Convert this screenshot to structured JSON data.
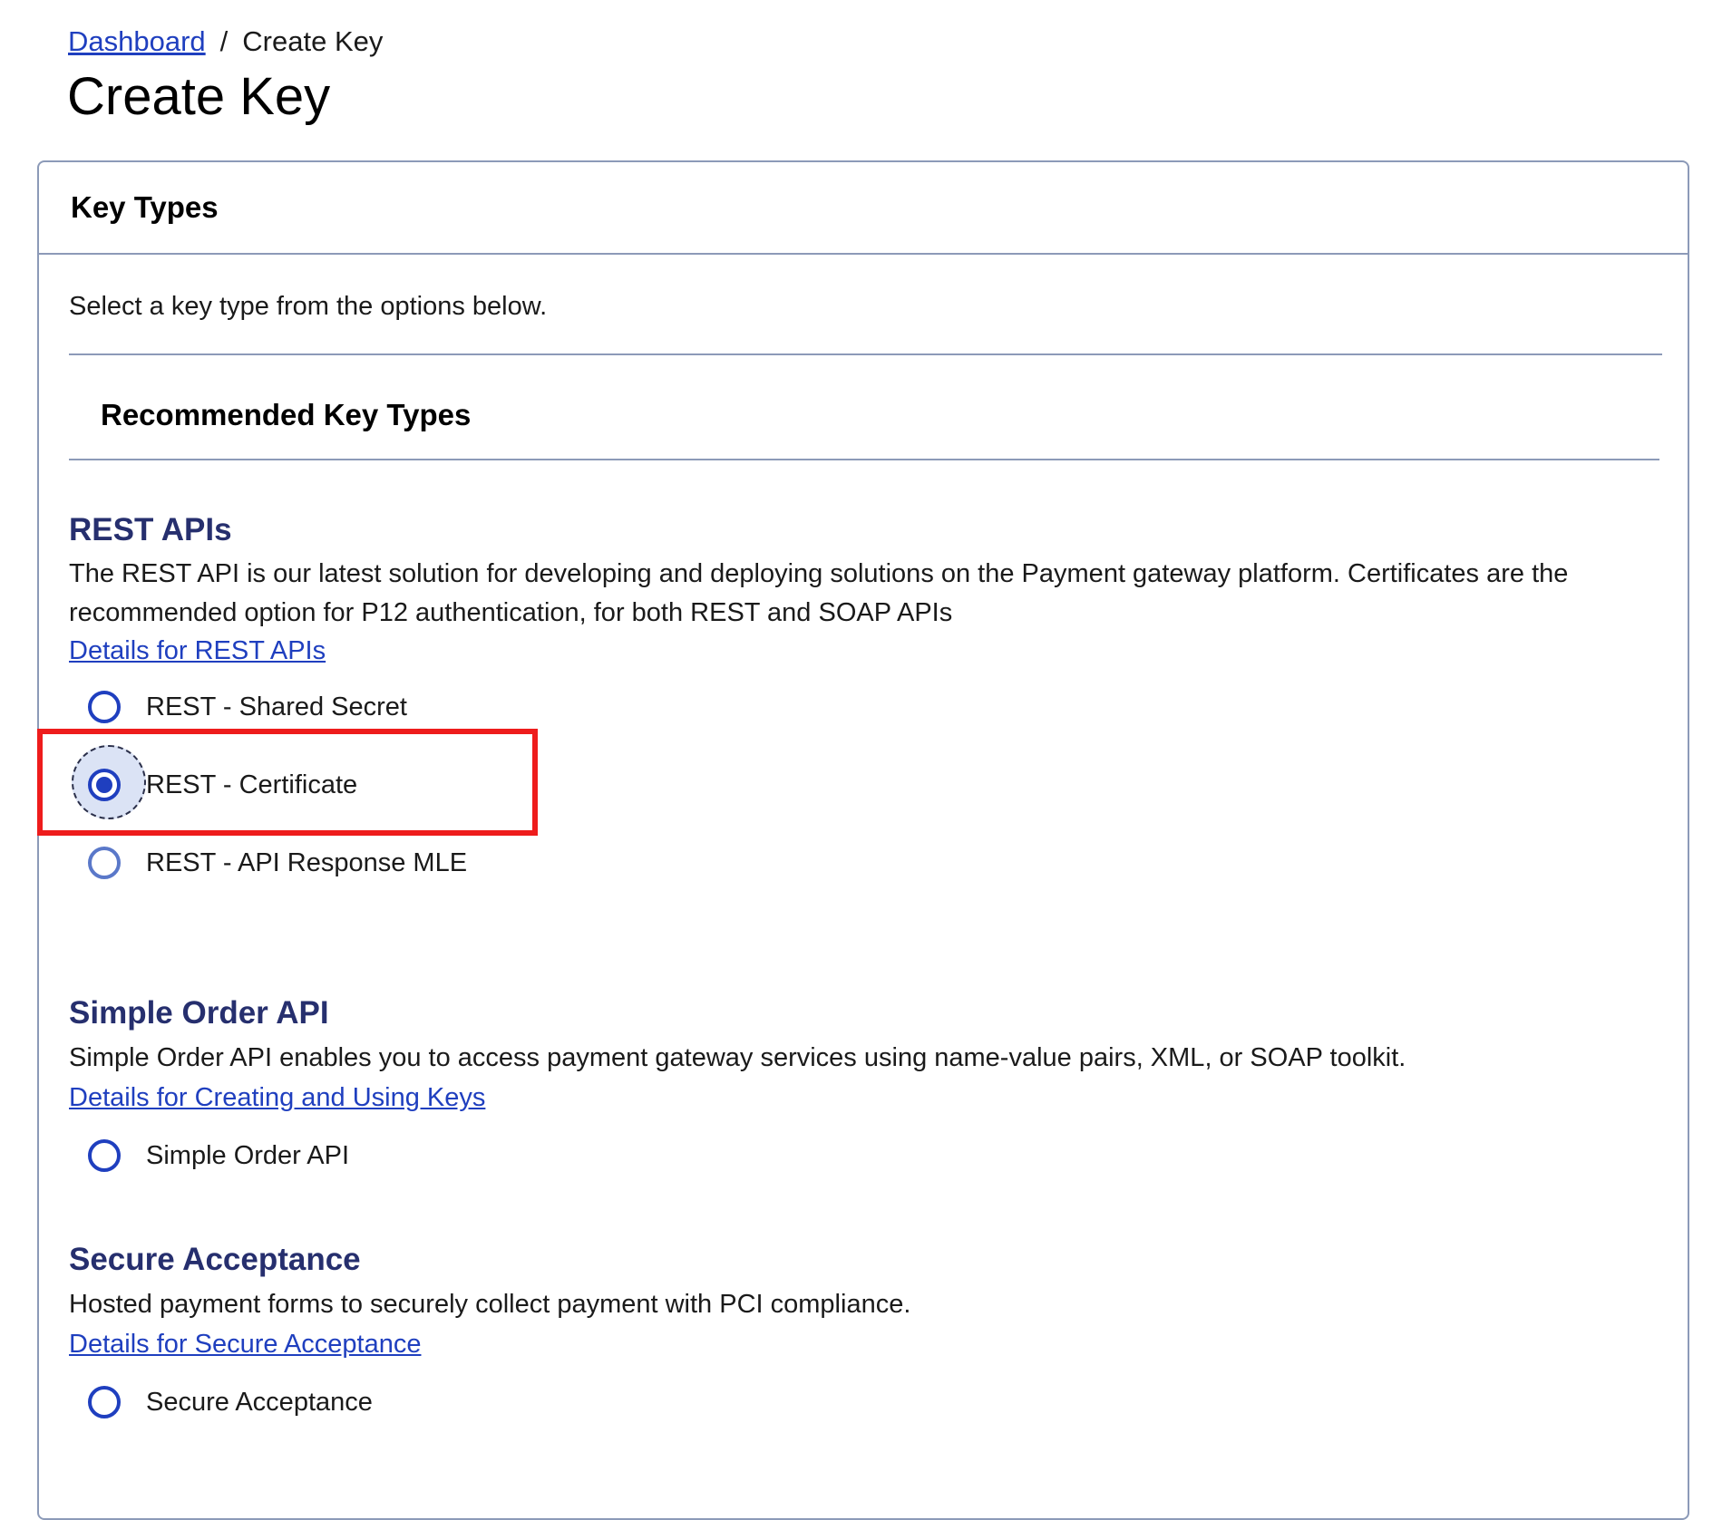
{
  "breadcrumb": {
    "parent_label": "Dashboard",
    "separator": "/",
    "current_label": "Create Key"
  },
  "page": {
    "title": "Create Key"
  },
  "card": {
    "header_title": "Key Types",
    "intro_text": "Select a key type from the options below.",
    "recommended_heading": "Recommended Key Types"
  },
  "sections": {
    "rest": {
      "title": "REST APIs",
      "description": "The REST API is our latest solution for developing and deploying solutions on the Payment gateway platform. Certificates are the recommended option for P12 authentication, for both REST and SOAP APIs",
      "link_label": "Details for REST APIs",
      "options": [
        {
          "label": "REST - Shared Secret",
          "checked": false
        },
        {
          "label": "REST - Certificate",
          "checked": true
        },
        {
          "label": "REST - API Response MLE",
          "checked": false
        }
      ]
    },
    "simple_order": {
      "title": "Simple Order API",
      "description": "Simple Order API enables you to access payment gateway services using name-value pairs, XML, or SOAP toolkit.",
      "link_label": "Details for Creating and Using Keys",
      "options": [
        {
          "label": "Simple Order API",
          "checked": false
        }
      ]
    },
    "secure_acceptance": {
      "title": "Secure Acceptance",
      "description": "Hosted payment forms to securely collect payment with PCI compliance.",
      "link_label": "Details for Secure Acceptance",
      "options": [
        {
          "label": "Secure Acceptance",
          "checked": false
        }
      ]
    }
  },
  "colors": {
    "link": "#1f3fbf",
    "section_title": "#262f6e",
    "radio": "#1f3fbf",
    "card_border": "#8c9ab8",
    "highlight_box": "#ee1c1c"
  }
}
